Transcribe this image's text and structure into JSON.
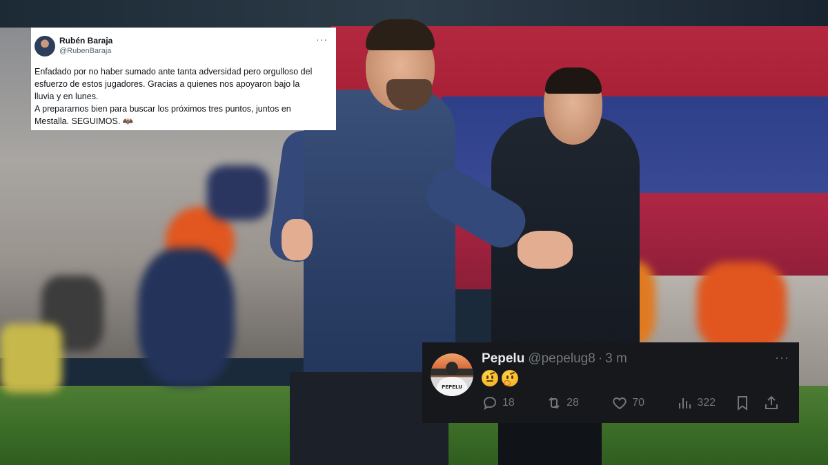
{
  "tweet_main": {
    "author_name": "Rubén Baraja",
    "author_handle": "@RubenBaraja",
    "more": "···",
    "lines": [
      "Enfadado por no haber sumado ante tanta adversidad pero orgulloso del",
      "esfuerzo de estos jugadores. Gracias a quienes nos apoyaron bajo la",
      "lluvia y en lunes.",
      "A prepararnos bien para buscar los próximos tres puntos, juntos en",
      "Mestalla. SEGUIMOS. 🦇"
    ]
  },
  "tweet_reply": {
    "author_name": "Pepelu",
    "author_handle": "@pepelug8",
    "separator": "·",
    "time": "3 m",
    "more": "···",
    "avatar_shirt_text": "PEPELU",
    "emojis": [
      "face-with-raised-eyebrow",
      "thinking-face"
    ],
    "actions": {
      "reply_count": "18",
      "retweet_count": "28",
      "like_count": "70",
      "views_count": "322"
    }
  }
}
